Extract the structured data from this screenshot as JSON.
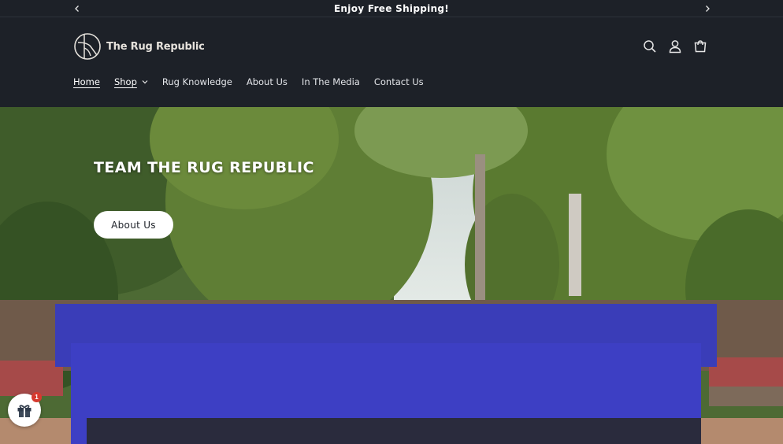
{
  "announcement": {
    "text": "Enjoy Free Shipping!",
    "prev_icon": "chevron-left-icon",
    "next_icon": "chevron-right-icon"
  },
  "header": {
    "logo_text": "The Rug Republic",
    "icons": [
      "search-icon",
      "account-icon",
      "cart-icon"
    ]
  },
  "nav": {
    "items": [
      {
        "label": "Home",
        "active": true
      },
      {
        "label": "Shop",
        "has_dropdown": true
      },
      {
        "label": "Rug Knowledge"
      },
      {
        "label": "About Us"
      },
      {
        "label": "In The Media"
      },
      {
        "label": "Contact Us"
      }
    ]
  },
  "hero": {
    "title": "TEAM THE RUG REPUBLIC",
    "button_label": "About Us"
  },
  "gift_widget": {
    "icon": "gift-icon",
    "badge_count": "1"
  },
  "colors": {
    "header_bg": "#1d2128",
    "shirt_blue": "#3d3fc4",
    "badge_red": "#d63a2f"
  }
}
